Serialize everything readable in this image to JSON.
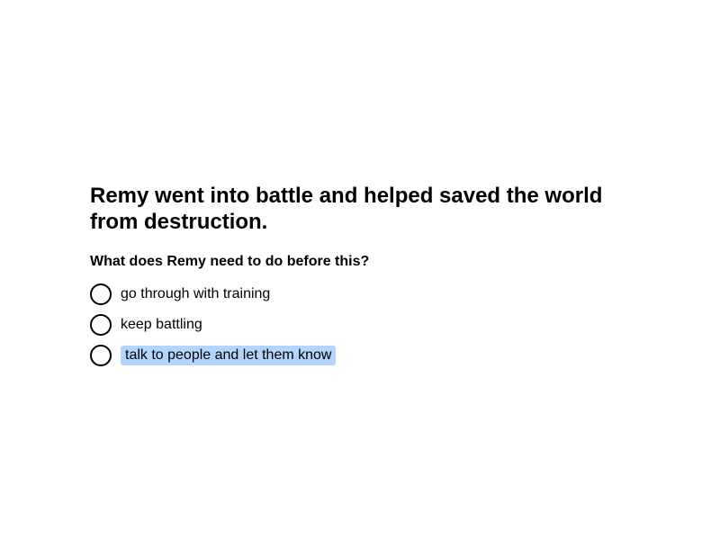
{
  "statement": "Remy went into battle and helped saved the world from destruction.",
  "question": "What does Remy need to do before this?",
  "options": [
    {
      "label": "go through with training"
    },
    {
      "label": "keep battling"
    },
    {
      "label": "talk to people and let them know"
    }
  ],
  "highlighted_option_index": 2,
  "colors": {
    "highlight": "#b3d4fc",
    "text": "#000000",
    "background": "#ffffff"
  }
}
